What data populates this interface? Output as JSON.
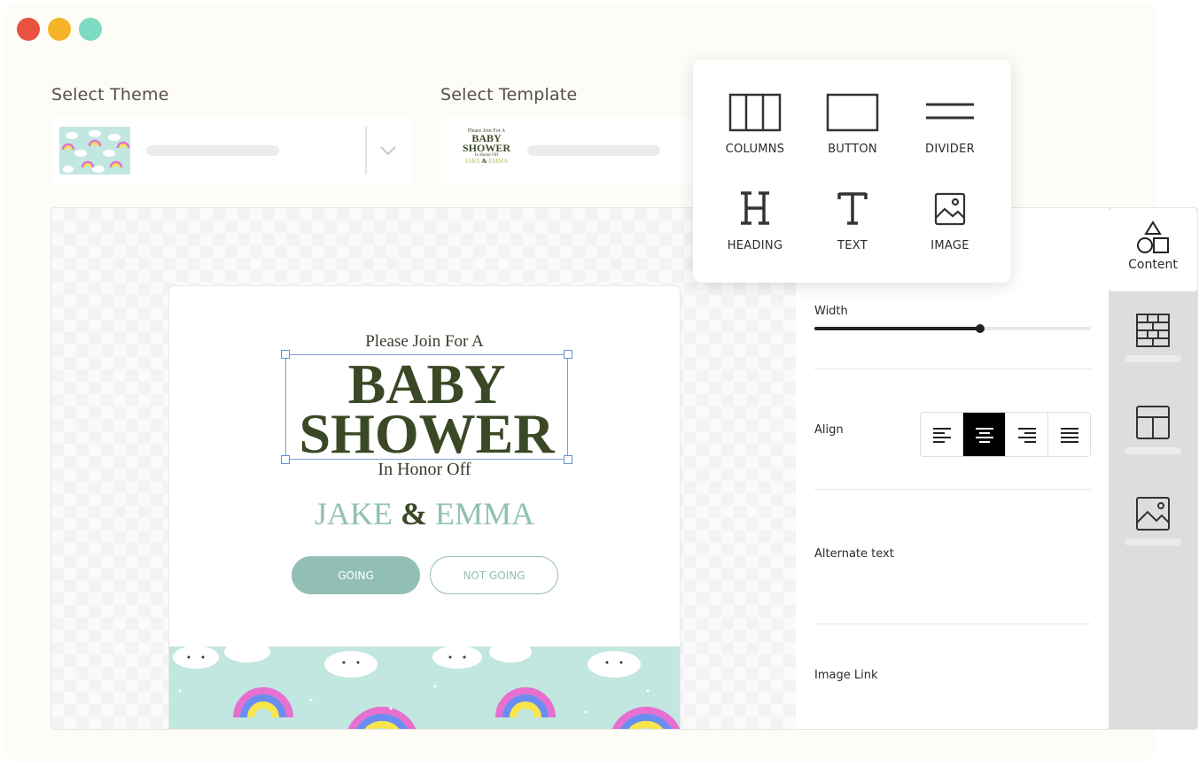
{
  "window": {
    "controls": [
      "close",
      "minimize",
      "maximize"
    ]
  },
  "theme_select": {
    "label": "Select Theme"
  },
  "template_select": {
    "label": "Select Template",
    "thumb": {
      "line1": "Please Join For A",
      "line2": "BABY",
      "line3": "SHOWER",
      "line4": "In Honor Off",
      "name1": "JAKE",
      "amp": "&",
      "name2": "EMMA"
    }
  },
  "content_popup": {
    "items": [
      {
        "label": "COLUMNS",
        "icon": "columns-icon"
      },
      {
        "label": "BUTTON",
        "icon": "button-icon"
      },
      {
        "label": "DIVIDER",
        "icon": "divider-icon"
      },
      {
        "label": "HEADING",
        "icon": "heading-icon"
      },
      {
        "label": "TEXT",
        "icon": "text-icon"
      },
      {
        "label": "IMAGE",
        "icon": "image-icon"
      }
    ]
  },
  "card": {
    "line1": "Please Join For A",
    "title_line1": "BABY",
    "title_line2": "SHOWER",
    "line2": "In Honor Off",
    "name1": "JAKE",
    "amp": "&",
    "name2": "EMMA",
    "going_label": "GOING",
    "not_going_label": "NOT GOING"
  },
  "properties": {
    "width_label": "Width",
    "width_value": 0.6,
    "align_label": "Align",
    "align_selected": "center",
    "align_options": [
      "left",
      "center",
      "right",
      "justify"
    ],
    "alt_text_label": "Alternate text",
    "image_link_label": "Image Link"
  },
  "side_tabs": {
    "content_label": "Content",
    "tabs": [
      "shapes-icon",
      "blocks-icon",
      "layout-icon",
      "image-icon"
    ]
  },
  "colors": {
    "accent": "#92bfb5",
    "title": "#3b4825",
    "pattern_bg": "#c2e6e0"
  }
}
